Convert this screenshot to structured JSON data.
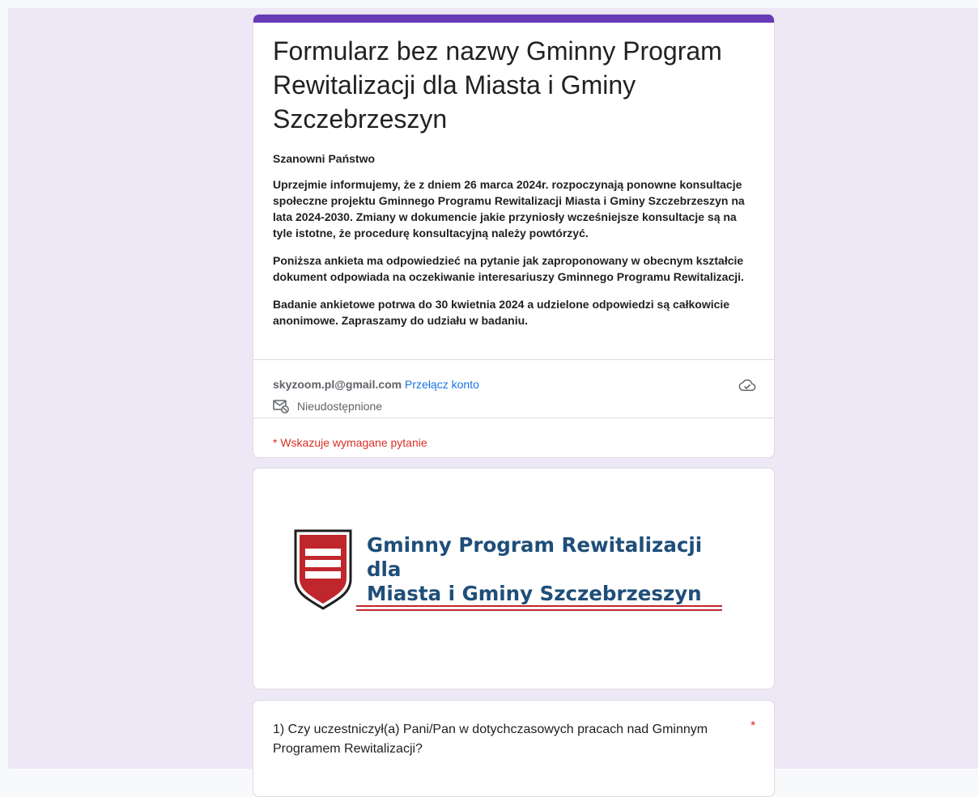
{
  "colors": {
    "accent": "#673ab7",
    "background": "#ede7f6",
    "link": "#1a73e8",
    "required": "#d93025",
    "logo_blue": "#1f4e79",
    "logo_red": "#c0272d"
  },
  "form": {
    "title": "Formularz bez nazwy Gminny Program Rewitalizacji dla Miasta i Gminy Szczebrzeszyn",
    "description": [
      "Szanowni Państwo",
      "Uprzejmie informujemy, że z dniem 26 marca 2024r.  rozpoczynają ponowne konsultacje społeczne projektu Gminnego Programu Rewitalizacji Miasta i Gminy Szczebrzeszyn na lata 2024-2030. Zmiany w dokumencie jakie przyniosły wcześniejsze konsultacje są na tyle istotne, że procedurę konsultacyjną należy powtórzyć.",
      "Poniższa ankieta ma odpowiedzieć na pytanie jak zaproponowany w obecnym kształcie dokument odpowiada na oczekiwanie interesariuszy Gminnego Programu Rewitalizacji.",
      "Badanie ankietowe potrwa do 30 kwietnia 2024 a udzielone odpowiedzi są całkowicie anonimowe. Zapraszamy do udziału w badaniu."
    ]
  },
  "account": {
    "email": "skyzoom.pl@gmail.com",
    "switch_label": "Przełącz konto",
    "not_shared_label": "Nieudostępnione",
    "save_status_icon": "cloud-check-icon",
    "not_shared_icon": "mail-off-icon"
  },
  "required_note": "* Wskazuje wymagane pytanie",
  "banner": {
    "line1": "Gminny Program Rewitalizacji dla",
    "line2": "Miasta i Gminy Szczebrzeszyn"
  },
  "questions": [
    {
      "text": "1) Czy uczestniczył(a) Pani/Pan w dotychczasowych pracach nad Gminnym Programem Rewitalizacji?",
      "required_mark": "*"
    }
  ]
}
